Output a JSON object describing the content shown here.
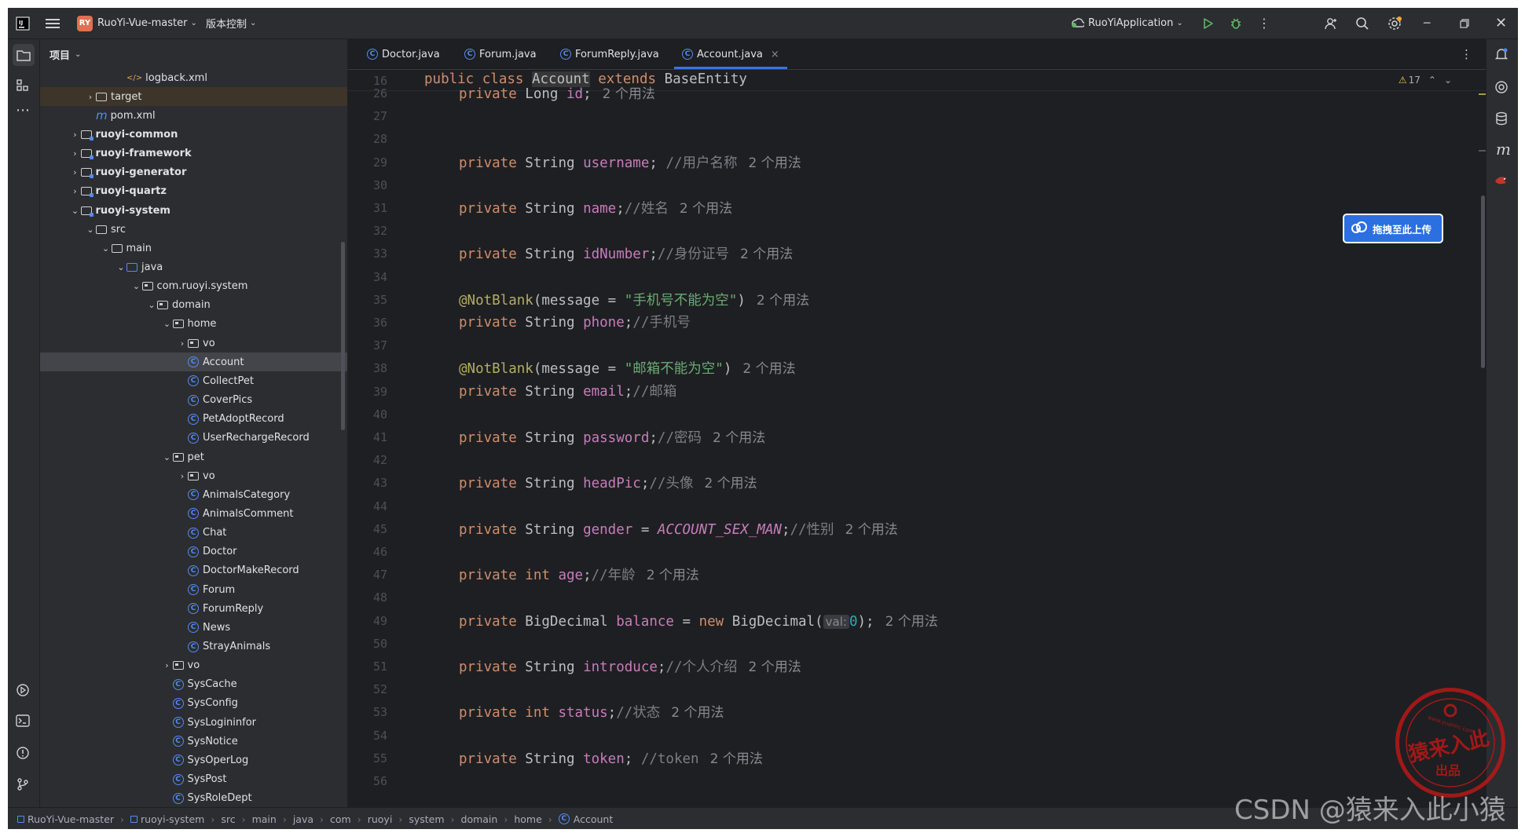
{
  "titlebar": {
    "project_badge": "RY",
    "project_name": "RuoYi-Vue-master",
    "vcs_label": "版本控制",
    "run_config": "RuoYiApplication"
  },
  "project_panel": {
    "title": "项目",
    "tree": [
      {
        "label": "logback.xml",
        "kind": "xml",
        "indent": 4,
        "chev": ""
      },
      {
        "label": "target",
        "kind": "folder",
        "indent": 2,
        "chev": "›"
      },
      {
        "label": "pom.xml",
        "kind": "maven",
        "indent": 2,
        "chev": ""
      },
      {
        "label": "ruoyi-common",
        "kind": "module",
        "indent": 1,
        "chev": "›",
        "bold": true
      },
      {
        "label": "ruoyi-framework",
        "kind": "module",
        "indent": 1,
        "chev": "›",
        "bold": true
      },
      {
        "label": "ruoyi-generator",
        "kind": "module",
        "indent": 1,
        "chev": "›",
        "bold": true
      },
      {
        "label": "ruoyi-quartz",
        "kind": "module",
        "indent": 1,
        "chev": "›",
        "bold": true
      },
      {
        "label": "ruoyi-system",
        "kind": "module",
        "indent": 1,
        "chev": "⌄",
        "bold": true
      },
      {
        "label": "src",
        "kind": "folder",
        "indent": 2,
        "chev": "⌄"
      },
      {
        "label": "main",
        "kind": "folder",
        "indent": 3,
        "chev": "⌄"
      },
      {
        "label": "java",
        "kind": "folder-blue",
        "indent": 4,
        "chev": "⌄"
      },
      {
        "label": "com.ruoyi.system",
        "kind": "package",
        "indent": 5,
        "chev": "⌄"
      },
      {
        "label": "domain",
        "kind": "package",
        "indent": 6,
        "chev": "⌄"
      },
      {
        "label": "home",
        "kind": "package",
        "indent": 7,
        "chev": "⌄"
      },
      {
        "label": "vo",
        "kind": "package",
        "indent": 8,
        "chev": "›"
      },
      {
        "label": "Account",
        "kind": "class",
        "indent": 8,
        "chev": "",
        "selected": true
      },
      {
        "label": "CollectPet",
        "kind": "class",
        "indent": 8,
        "chev": ""
      },
      {
        "label": "CoverPics",
        "kind": "class",
        "indent": 8,
        "chev": ""
      },
      {
        "label": "PetAdoptRecord",
        "kind": "class",
        "indent": 8,
        "chev": ""
      },
      {
        "label": "UserRechargeRecord",
        "kind": "class",
        "indent": 8,
        "chev": ""
      },
      {
        "label": "pet",
        "kind": "package",
        "indent": 7,
        "chev": "⌄"
      },
      {
        "label": "vo",
        "kind": "package",
        "indent": 8,
        "chev": "›"
      },
      {
        "label": "AnimalsCategory",
        "kind": "class",
        "indent": 8,
        "chev": ""
      },
      {
        "label": "AnimalsComment",
        "kind": "class",
        "indent": 8,
        "chev": ""
      },
      {
        "label": "Chat",
        "kind": "class",
        "indent": 8,
        "chev": ""
      },
      {
        "label": "Doctor",
        "kind": "class",
        "indent": 8,
        "chev": ""
      },
      {
        "label": "DoctorMakeRecord",
        "kind": "class",
        "indent": 8,
        "chev": ""
      },
      {
        "label": "Forum",
        "kind": "class",
        "indent": 8,
        "chev": ""
      },
      {
        "label": "ForumReply",
        "kind": "class",
        "indent": 8,
        "chev": ""
      },
      {
        "label": "News",
        "kind": "class",
        "indent": 8,
        "chev": ""
      },
      {
        "label": "StrayAnimals",
        "kind": "class",
        "indent": 8,
        "chev": ""
      },
      {
        "label": "vo",
        "kind": "package",
        "indent": 7,
        "chev": "›"
      },
      {
        "label": "SysCache",
        "kind": "class",
        "indent": 7,
        "chev": ""
      },
      {
        "label": "SysConfig",
        "kind": "class",
        "indent": 7,
        "chev": ""
      },
      {
        "label": "SysLogininfor",
        "kind": "class",
        "indent": 7,
        "chev": ""
      },
      {
        "label": "SysNotice",
        "kind": "class",
        "indent": 7,
        "chev": ""
      },
      {
        "label": "SysOperLog",
        "kind": "class",
        "indent": 7,
        "chev": ""
      },
      {
        "label": "SysPost",
        "kind": "class",
        "indent": 7,
        "chev": ""
      },
      {
        "label": "SysRoleDept",
        "kind": "class",
        "indent": 7,
        "chev": ""
      }
    ]
  },
  "tabs": [
    {
      "label": "Doctor.java"
    },
    {
      "label": "Forum.java"
    },
    {
      "label": "ForumReply.java"
    },
    {
      "label": "Account.java",
      "active": true,
      "close": "×"
    }
  ],
  "editor": {
    "warnings": "17",
    "sticky": {
      "num": "16",
      "text_kw1": "public class ",
      "text_cls": "Account",
      "text_kw2": " extends ",
      "text_base": "BaseEntity"
    },
    "lines": [
      {
        "num": "26",
        "type": "field",
        "kw": "private ",
        "typ": "Long ",
        "name": "id",
        "tail": ";",
        "comment": "",
        "hint": "2 个用法"
      },
      {
        "num": "27",
        "type": "blank"
      },
      {
        "num": "28",
        "type": "blank"
      },
      {
        "num": "29",
        "type": "field",
        "kw": "private ",
        "typ": "String ",
        "name": "username",
        "tail": "; ",
        "comment": "//用户名称",
        "hint": "2 个用法"
      },
      {
        "num": "30",
        "type": "blank"
      },
      {
        "num": "31",
        "type": "field",
        "kw": "private ",
        "typ": "String ",
        "name": "name",
        "tail": ";",
        "comment": "//姓名",
        "hint": "2 个用法"
      },
      {
        "num": "32",
        "type": "blank"
      },
      {
        "num": "33",
        "type": "field",
        "kw": "private ",
        "typ": "String ",
        "name": "idNumber",
        "tail": ";",
        "comment": "//身份证号",
        "hint": "2 个用法"
      },
      {
        "num": "34",
        "type": "blank"
      },
      {
        "num": "35",
        "type": "annot",
        "ann": "@NotBlank",
        "pre": "(message = ",
        "str": "\"手机号不能为空\"",
        "post": ")",
        "hint": "2 个用法"
      },
      {
        "num": "36",
        "type": "field",
        "kw": "private ",
        "typ": "String ",
        "name": "phone",
        "tail": ";",
        "comment": "//手机号",
        "hint": ""
      },
      {
        "num": "37",
        "type": "blank"
      },
      {
        "num": "38",
        "type": "annot",
        "ann": "@NotBlank",
        "pre": "(message = ",
        "str": "\"邮箱不能为空\"",
        "post": ")",
        "hint": "2 个用法"
      },
      {
        "num": "39",
        "type": "field",
        "kw": "private ",
        "typ": "String ",
        "name": "email",
        "tail": ";",
        "comment": "//邮箱",
        "hint": ""
      },
      {
        "num": "40",
        "type": "blank"
      },
      {
        "num": "41",
        "type": "field",
        "kw": "private ",
        "typ": "String ",
        "name": "password",
        "tail": ";",
        "comment": "//密码",
        "hint": "2 个用法"
      },
      {
        "num": "42",
        "type": "blank"
      },
      {
        "num": "43",
        "type": "field",
        "kw": "private ",
        "typ": "String ",
        "name": "headPic",
        "tail": ";",
        "comment": "//头像",
        "hint": "2 个用法"
      },
      {
        "num": "44",
        "type": "blank"
      },
      {
        "num": "45",
        "type": "const",
        "kw": "private ",
        "typ": "String ",
        "name": "gender",
        "mid": " = ",
        "constv": "ACCOUNT_SEX_MAN",
        "tail": ";",
        "comment": "//性别",
        "hint": "2 个用法"
      },
      {
        "num": "46",
        "type": "blank"
      },
      {
        "num": "47",
        "type": "prim",
        "kw": "private ",
        "typ": "int ",
        "name": "age",
        "tail": ";",
        "comment": "//年龄",
        "hint": "2 个用法"
      },
      {
        "num": "48",
        "type": "blank"
      },
      {
        "num": "49",
        "type": "bigdec",
        "kw": "private ",
        "typ": "BigDecimal ",
        "name": "balance",
        "mid": " = ",
        "newkw": "new ",
        "ctor": "BigDecimal(",
        "inlay": "val:",
        "numv": "0",
        "tail": ");",
        "hint": "2 个用法"
      },
      {
        "num": "50",
        "type": "blank"
      },
      {
        "num": "51",
        "type": "field",
        "kw": "private ",
        "typ": "String ",
        "name": "introduce",
        "tail": ";",
        "comment": "//个人介绍",
        "hint": "2 个用法"
      },
      {
        "num": "52",
        "type": "blank"
      },
      {
        "num": "53",
        "type": "prim",
        "kw": "private ",
        "typ": "int ",
        "name": "status",
        "tail": ";",
        "comment": "//状态",
        "hint": "2 个用法"
      },
      {
        "num": "54",
        "type": "blank"
      },
      {
        "num": "55",
        "type": "field",
        "kw": "private ",
        "typ": "String ",
        "name": "token",
        "tail": "; ",
        "comment": "//token",
        "hint": "2 个用法"
      },
      {
        "num": "56",
        "type": "blank"
      }
    ]
  },
  "upload_button": {
    "label": "拖拽至此上传"
  },
  "breadcrumb": [
    "RuoYi-Vue-master",
    "ruoyi-system",
    "src",
    "main",
    "java",
    "com",
    "ruoyi",
    "system",
    "domain",
    "home",
    "Account"
  ],
  "stamp": {
    "line1": "猿来入此",
    "line2": "出品",
    "url": "www.yuanlrc.com"
  },
  "watermark": "CSDN @猿来入此小猿"
}
